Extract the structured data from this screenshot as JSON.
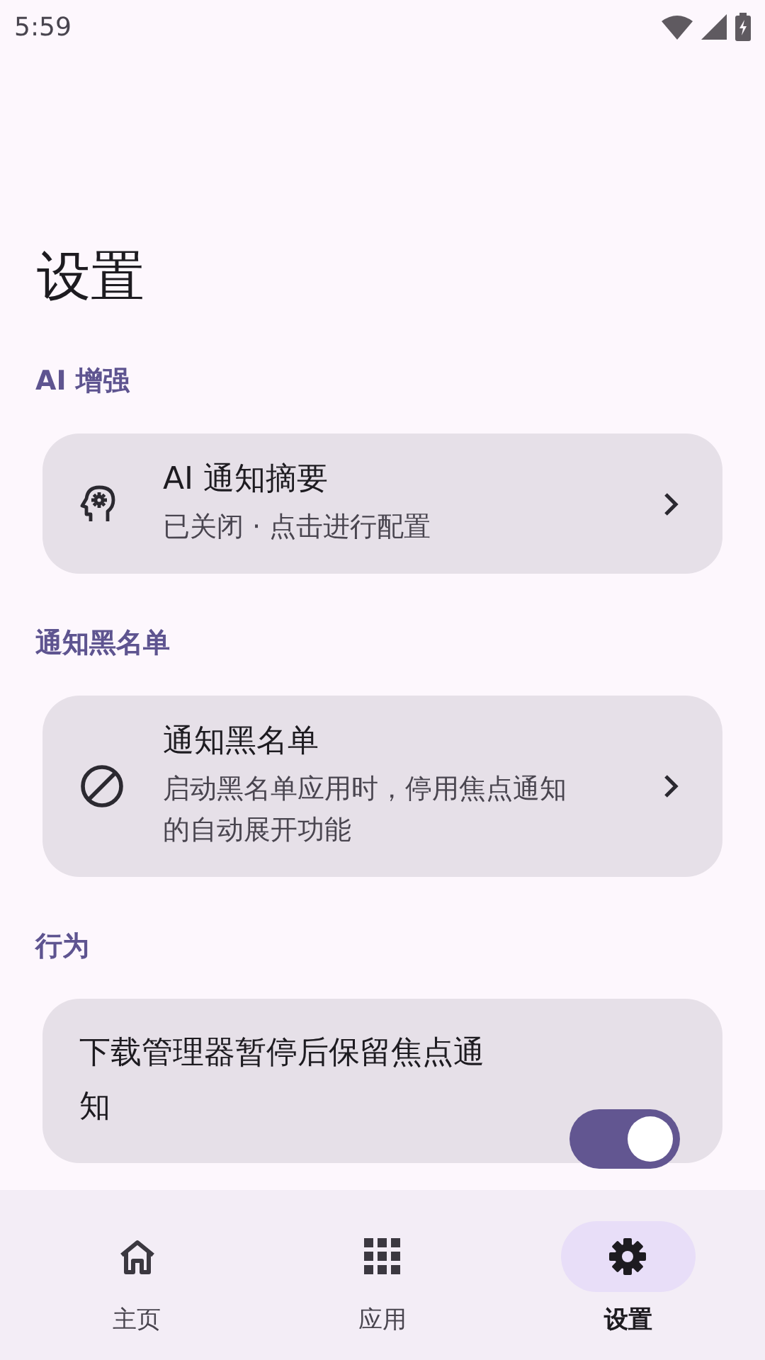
{
  "status_bar": {
    "time": "5:59"
  },
  "title": "设置",
  "sections": [
    {
      "header": "AI 增强",
      "items": [
        {
          "kind": "link",
          "title": "AI 通知摘要",
          "subtitle": "已关闭 · 点击进行配置"
        }
      ]
    },
    {
      "header": "通知黑名单",
      "items": [
        {
          "kind": "link",
          "title": "通知黑名单",
          "subtitle": "启动黑名单应用时，停用焦点通知的自动展开功能"
        }
      ]
    },
    {
      "header": "行为",
      "items": [
        {
          "kind": "toggle",
          "title": "下载管理器暂停后保留焦点通知",
          "on": true
        }
      ]
    }
  ],
  "bottom_nav": [
    {
      "label": "主页",
      "selected": false
    },
    {
      "label": "应用",
      "selected": false
    },
    {
      "label": "设置",
      "selected": true
    }
  ]
}
